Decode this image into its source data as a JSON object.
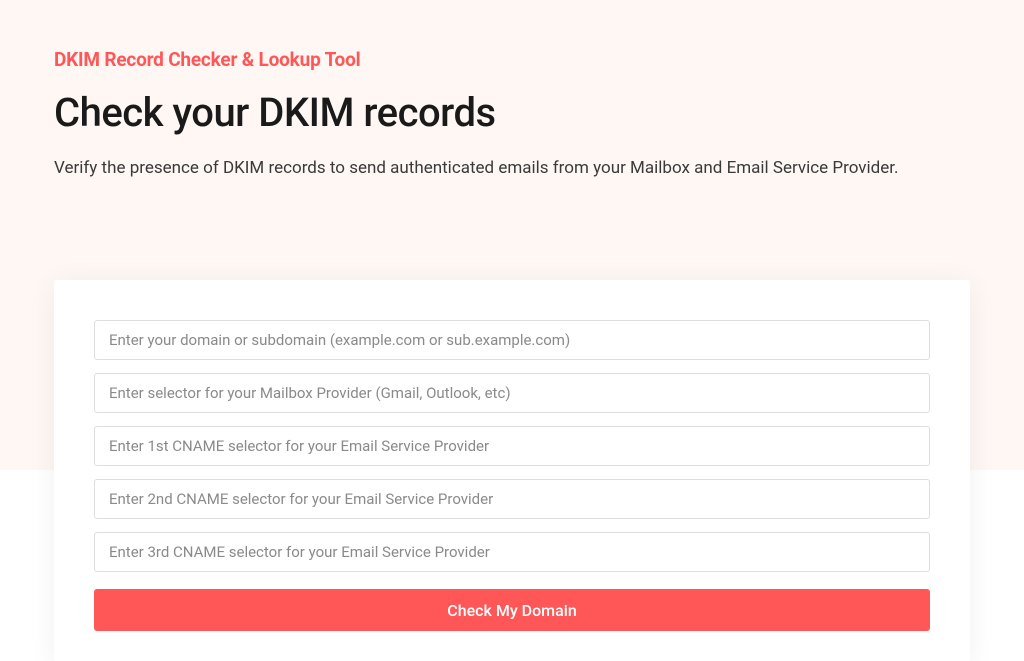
{
  "header": {
    "tool_label": "DKIM Record Checker & Lookup Tool",
    "title": "Check your DKIM records",
    "description": "Verify the presence of DKIM records to send authenticated emails from your Mailbox and Email Service Provider."
  },
  "form": {
    "domain_placeholder": "Enter your domain or subdomain (example.com or sub.example.com)",
    "mailbox_selector_placeholder": "Enter selector for your Mailbox Provider (Gmail, Outlook, etc)",
    "cname1_placeholder": "Enter 1st CNAME selector for your Email Service Provider",
    "cname2_placeholder": "Enter 2nd CNAME selector for your Email Service Provider",
    "cname3_placeholder": "Enter 3rd CNAME selector for your Email Service Provider",
    "submit_label": "Check My Domain"
  }
}
